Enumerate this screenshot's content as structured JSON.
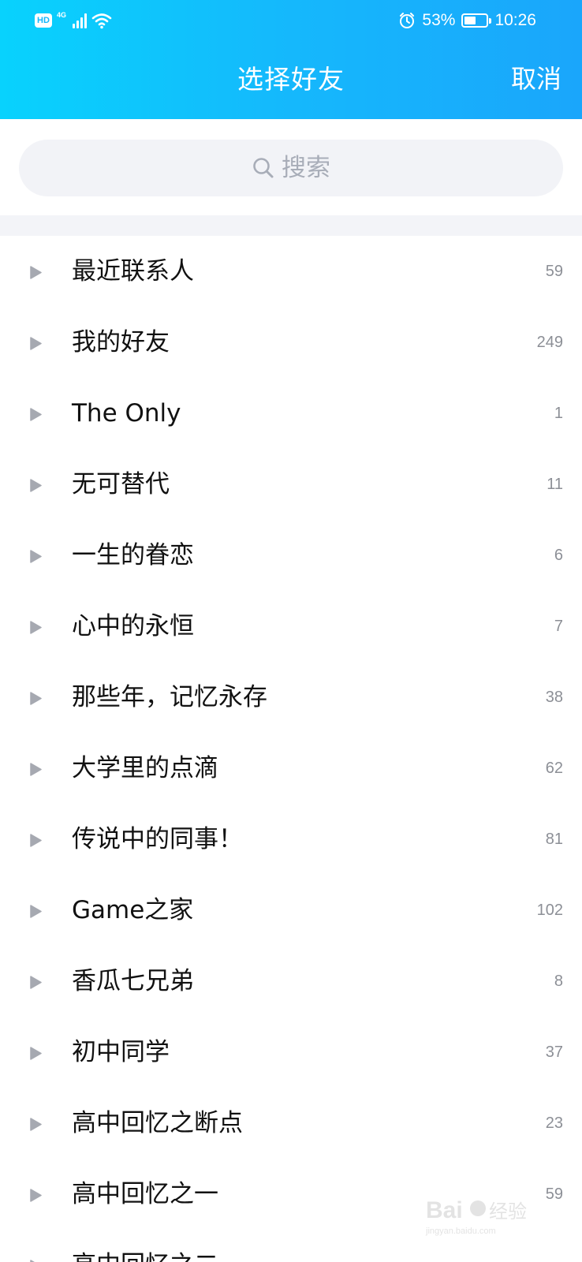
{
  "status_bar": {
    "hd": "HD",
    "network": "4G",
    "battery_percent": "53%",
    "battery_level": 0.53,
    "time": "10:26"
  },
  "header": {
    "title": "选择好友",
    "cancel_label": "取消"
  },
  "search": {
    "placeholder": "搜索"
  },
  "groups": [
    {
      "name": "最近联系人",
      "count": "59"
    },
    {
      "name": "我的好友",
      "count": "249"
    },
    {
      "name": "The Only",
      "count": "1"
    },
    {
      "name": "无可替代",
      "count": "11"
    },
    {
      "name": "一生的眷恋",
      "count": "6"
    },
    {
      "name": "心中的永恒",
      "count": "7"
    },
    {
      "name": "那些年，记忆永存",
      "count": "38"
    },
    {
      "name": "大学里的点滴",
      "count": "62"
    },
    {
      "name": "传说中的同事！",
      "count": "81"
    },
    {
      "name": "Game之家",
      "count": "102"
    },
    {
      "name": "香瓜七兄弟",
      "count": "8"
    },
    {
      "name": "初中同学",
      "count": "37"
    },
    {
      "name": "高中回忆之断点",
      "count": "23"
    },
    {
      "name": "高中回忆之一",
      "count": "59"
    },
    {
      "name": "高中回忆之二",
      "count": ""
    }
  ],
  "colors": {
    "header_start": "#08d2fd",
    "header_end": "#1aa6fb",
    "arrow": "#a6a9b1",
    "count": "#8c8f96"
  },
  "watermark": {
    "brand": "Bai",
    "brand_suffix": "经验",
    "url": "jingyan.baidu.com"
  }
}
